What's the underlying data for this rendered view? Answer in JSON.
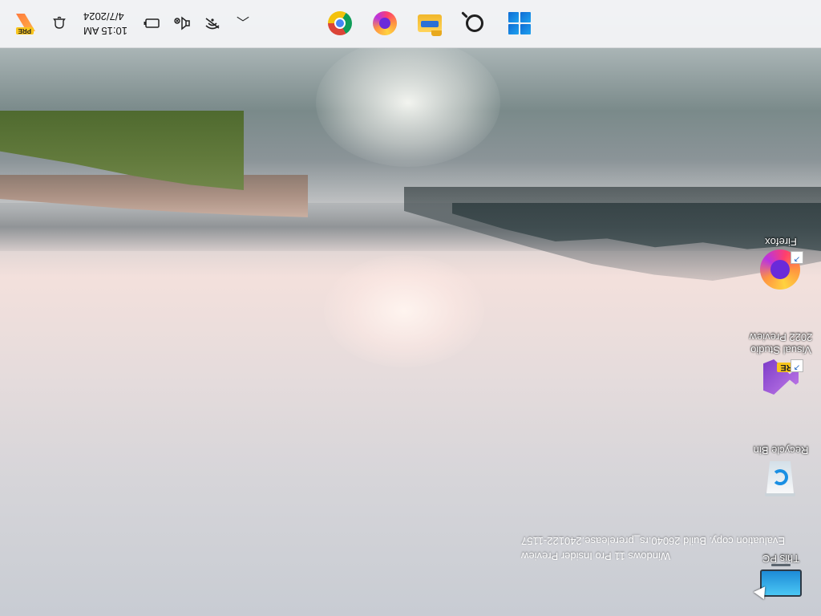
{
  "desktop": {
    "icons": [
      {
        "label": "This PC",
        "icon": "monitor-icon"
      },
      {
        "label": "Recycle Bin",
        "icon": "recycle-bin-icon"
      },
      {
        "label": "Visual Studio 2022 Preview",
        "icon": "visual-studio-icon",
        "badge": "PRE"
      },
      {
        "label": "Firefox",
        "icon": "firefox-icon"
      }
    ],
    "watermark": {
      "line1": "Windows 11 Pro Insider Preview",
      "line2": "Evaluation copy. Build 26040.rs_prerelease.240122-1157"
    }
  },
  "taskbar": {
    "pinned": [
      {
        "name": "start",
        "icon": "windows-logo-icon"
      },
      {
        "name": "search",
        "icon": "search-icon"
      },
      {
        "name": "file-explorer",
        "icon": "folder-icon"
      },
      {
        "name": "firefox",
        "icon": "firefox-icon"
      },
      {
        "name": "chrome",
        "icon": "chrome-icon"
      }
    ],
    "tray": {
      "overflow": "chevron-up-icon",
      "clock_time": "10:15 AM",
      "clock_date": "4/7/2024",
      "preview_badge": "PRE"
    }
  },
  "colors": {
    "accent": "#0f6cd4",
    "taskbar_bg": "#f2f3f5"
  }
}
